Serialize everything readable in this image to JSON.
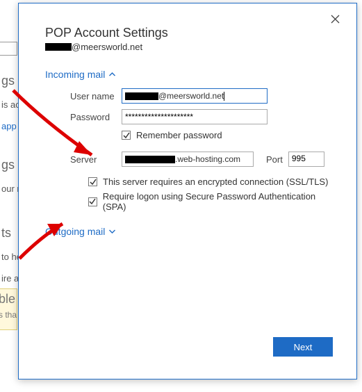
{
  "bg": {
    "h1": "gs",
    "t1": "is ac",
    "link": "app t",
    "h2": "gs",
    "t2": "our m",
    "h3": "ts",
    "t3": "to he",
    "t4": "ire ac",
    "box": "ble",
    "boxsub": "s tha"
  },
  "dialog": {
    "title": "POP Account Settings",
    "email_suffix": "@meersworld.net"
  },
  "incoming": {
    "header": "Incoming mail",
    "user_label": "User name",
    "user_suffix": "@meersworld.net",
    "pass_label": "Password",
    "pass_mask": "*********************",
    "remember": "Remember password",
    "server_label": "Server",
    "server_suffix": ".web-hosting.com",
    "port_label": "Port",
    "port_value": "995",
    "ssl": "This server requires an encrypted connection (SSL/TLS)",
    "spa": "Require logon using Secure Password Authentication (SPA)"
  },
  "outgoing": {
    "header": "Outgoing mail"
  },
  "buttons": {
    "next": "Next"
  }
}
